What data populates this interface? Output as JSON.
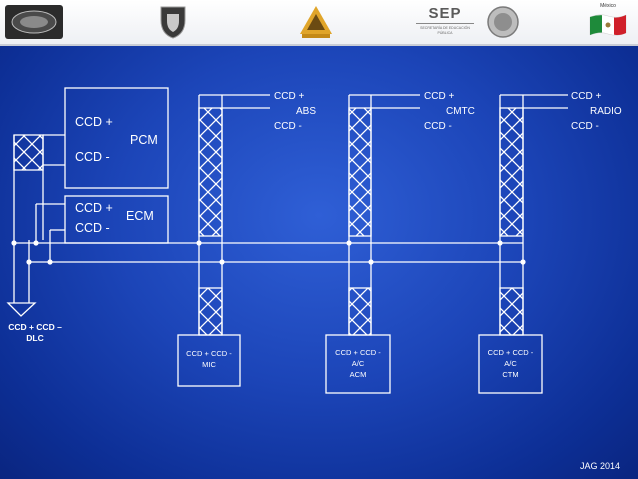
{
  "header": {
    "left_logo_icon": "institution-emblem-icon",
    "shield_logo_icon": "shield-crest-icon",
    "center_logo_icon": "triangle-emblem-icon",
    "sep_logo": {
      "title": "SEP",
      "subtitle": "SECRETARÍA DE EDUCACIÓN PÚBLICA"
    },
    "seal_logo_icon": "mexico-seal-icon",
    "flag": {
      "caption": "México",
      "icon": "mexico-flag-icon"
    }
  },
  "modules": {
    "pcm": {
      "line1": "CCD +",
      "name": "PCM",
      "line2": "CCD -"
    },
    "ecm": {
      "line1": "CCD +",
      "name": "ECM",
      "line2": "CCD -"
    },
    "abs": {
      "line1": "CCD +",
      "name": "ABS",
      "line2": "CCD -"
    },
    "cmtc": {
      "line1": "CCD +",
      "name": "CMTC",
      "line2": "CCD -"
    },
    "radio": {
      "line1": "CCD +",
      "name": "RADIO",
      "line2": "CCD -"
    },
    "mic": {
      "line1": "CCD + CCD -",
      "line2": "MIC"
    },
    "acm": {
      "line1": "CCD + CCD -",
      "line2": "A/C",
      "line3": "ACM"
    },
    "ctm": {
      "line1": "CCD + CCD -",
      "line2": "A/C",
      "line3": "CTM"
    }
  },
  "dlc": {
    "line1": "CCD + CCD –",
    "line2": "DLC"
  },
  "footer": {
    "credit": "JAG 2014"
  },
  "colors": {
    "background": "#1c45b8",
    "wire": "#ffffff",
    "header": "#f4f5f8"
  }
}
